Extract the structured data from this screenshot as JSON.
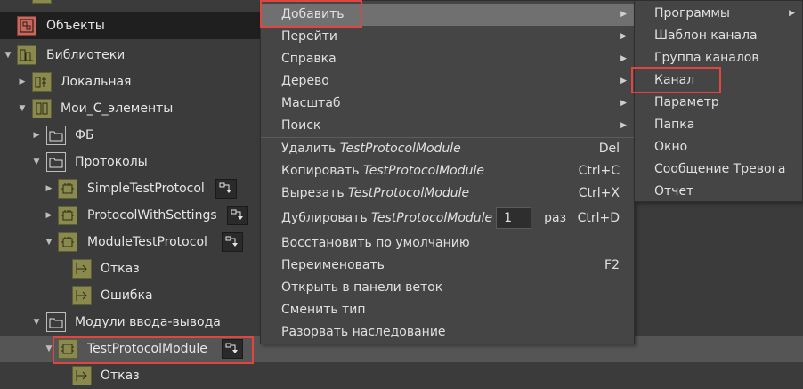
{
  "tree": {
    "objects": "Объекты",
    "libraries": "Библиотеки",
    "local": "Локальная",
    "my_elements": "Мои_С_элементы",
    "fb": "ФБ",
    "protocols": "Протоколы",
    "simple_test_protocol": "SimpleTestProtocol",
    "protocol_with_settings": "ProtocolWithSettings",
    "module_test_protocol": "ModuleTestProtocol",
    "failure1": "Отказ",
    "error1": "Ошибка",
    "io_modules": "Модули ввода-вывода",
    "test_protocol_module": "TestProtocolModule",
    "failure2": "Отказ"
  },
  "context_menu": {
    "add": "Добавить",
    "goto": "Перейти",
    "help": "Справка",
    "tree": "Дерево",
    "scale": "Масштаб",
    "search": "Поиск",
    "delete_prefix": "Удалить",
    "copy_prefix": "Копировать",
    "cut_prefix": "Вырезать",
    "duplicate_prefix": "Дублировать",
    "target": "TestProtocolModule",
    "delete_shortcut": "Del",
    "copy_shortcut": "Ctrl+C",
    "cut_shortcut": "Ctrl+X",
    "duplicate_count": "1",
    "duplicate_suffix": "раз",
    "duplicate_shortcut": "Ctrl+D",
    "restore_default": "Восстановить по умолчанию",
    "rename": "Переименовать",
    "rename_shortcut": "F2",
    "open_branch_panel": "Открыть в панели веток",
    "change_type": "Сменить тип",
    "break_inheritance": "Разорвать наследование"
  },
  "submenu": {
    "programs": "Программы",
    "channel_template": "Шаблон канала",
    "channel_group": "Группа каналов",
    "channel": "Канал",
    "parameter": "Параметр",
    "folder": "Папка",
    "window": "Окно",
    "alarm_message": "Сообщение Тревога",
    "report": "Отчет"
  },
  "colors": {
    "highlight": "#e0463f",
    "icon_olive": "#8b8a4e",
    "icon_red": "#c46a5e"
  }
}
